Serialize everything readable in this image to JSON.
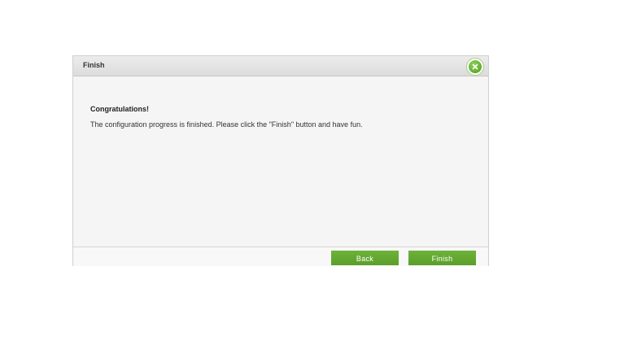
{
  "dialog": {
    "title": "Finish",
    "close_icon": "close-x-icon",
    "heading": "Congratulations!",
    "message": "The configuration progress is finished. Please click the \"Finish\" button and have fun.",
    "buttons": {
      "back_label": "Back",
      "finish_label": "Finish"
    },
    "colors": {
      "accent": "#5fa52d",
      "header_bg": "#e0e0e0",
      "body_bg": "#f5f5f5"
    }
  }
}
